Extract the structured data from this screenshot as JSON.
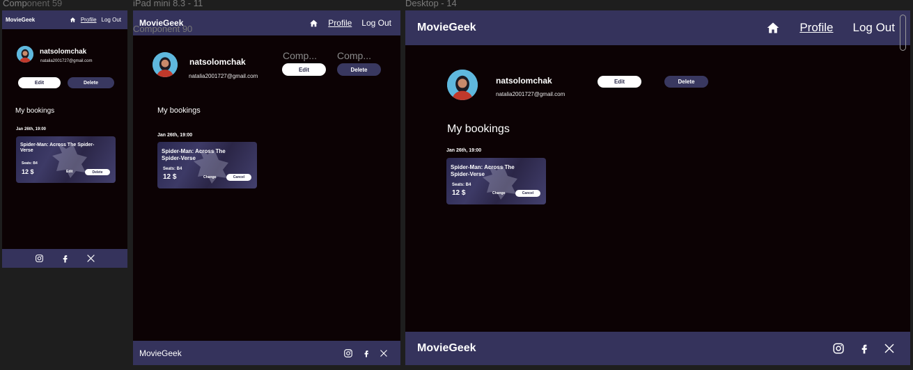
{
  "canvas_labels": {
    "mobile_a": "Comp",
    "mobile_b": "Component 59",
    "tablet_a": "iPad mini 8.3 - 11",
    "tablet_b": "Component 90",
    "desktop": "Desktop - 14"
  },
  "nav": {
    "brand": "MovieGeek",
    "profile": "Profile",
    "logout": "Log Out"
  },
  "user": {
    "name": "natsolomchak",
    "email": "natalia2001727@gmail.com"
  },
  "buttons": {
    "edit": "Edit",
    "delete": "Delete"
  },
  "tablet_ghost": {
    "comp1": "Comp...",
    "comp2": "Comp..."
  },
  "bookings": {
    "heading": "My bookings",
    "date": "Jan 26th, 19:00",
    "movie": "Spider-Man: Across The Spider-Verse",
    "seats": "Seats:  B4",
    "price": "12 $",
    "mobile_actions": [
      "Edit",
      "Delete"
    ],
    "actions": [
      "Change",
      "Cancel"
    ]
  },
  "footer": {
    "brand": "MovieGeek",
    "icons": [
      "instagram-icon",
      "facebook-icon",
      "x-icon"
    ]
  },
  "colors": {
    "background": "#0c0204",
    "nav": "#35335c",
    "button_dark": "#393860",
    "button_light": "#ffffff",
    "avatar": "#5fb8de"
  }
}
